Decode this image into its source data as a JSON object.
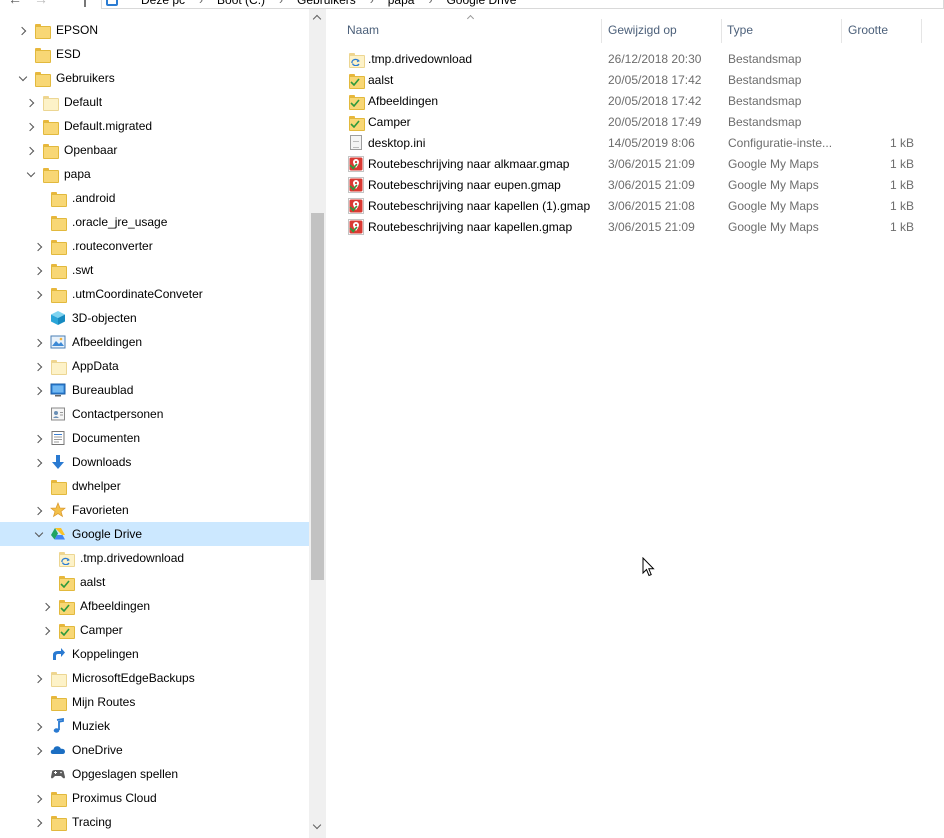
{
  "address": {
    "breadcrumbs": [
      "Deze pc",
      "Boot (C:)",
      "Gebruikers",
      "papa",
      "Google Drive"
    ],
    "separator": "›"
  },
  "nav": {
    "items": [
      {
        "label": "EPSON",
        "indent": 0,
        "expander": "collapsed",
        "icon": "folder-icon"
      },
      {
        "label": "ESD",
        "indent": 0,
        "expander": "none",
        "icon": "folder-icon"
      },
      {
        "label": "Gebruikers",
        "indent": 0,
        "expander": "expanded",
        "icon": "folder-icon"
      },
      {
        "label": "Default",
        "indent": 1,
        "expander": "collapsed",
        "icon": "folder-pale-icon"
      },
      {
        "label": "Default.migrated",
        "indent": 1,
        "expander": "collapsed",
        "icon": "folder-icon"
      },
      {
        "label": "Openbaar",
        "indent": 1,
        "expander": "collapsed",
        "icon": "folder-icon"
      },
      {
        "label": "papa",
        "indent": 1,
        "expander": "expanded",
        "icon": "folder-icon"
      },
      {
        "label": ".android",
        "indent": 2,
        "expander": "none",
        "icon": "folder-icon"
      },
      {
        "label": ".oracle_jre_usage",
        "indent": 2,
        "expander": "none",
        "icon": "folder-icon"
      },
      {
        "label": ".routeconverter",
        "indent": 2,
        "expander": "collapsed",
        "icon": "folder-icon"
      },
      {
        "label": ".swt",
        "indent": 2,
        "expander": "collapsed",
        "icon": "folder-icon"
      },
      {
        "label": ".utmCoordinateConveter",
        "indent": 2,
        "expander": "collapsed",
        "icon": "folder-icon"
      },
      {
        "label": "3D-objecten",
        "indent": 2,
        "expander": "none",
        "icon": "cube-3d-icon"
      },
      {
        "label": "Afbeeldingen",
        "indent": 2,
        "expander": "collapsed",
        "icon": "pictures-icon"
      },
      {
        "label": "AppData",
        "indent": 2,
        "expander": "collapsed",
        "icon": "folder-pale-icon"
      },
      {
        "label": "Bureaublad",
        "indent": 2,
        "expander": "collapsed",
        "icon": "desktop-icon"
      },
      {
        "label": "Contactpersonen",
        "indent": 2,
        "expander": "none",
        "icon": "contacts-icon"
      },
      {
        "label": "Documenten",
        "indent": 2,
        "expander": "collapsed",
        "icon": "documents-icon"
      },
      {
        "label": "Downloads",
        "indent": 2,
        "expander": "collapsed",
        "icon": "download-arrow-icon"
      },
      {
        "label": "dwhelper",
        "indent": 2,
        "expander": "none",
        "icon": "folder-icon"
      },
      {
        "label": "Favorieten",
        "indent": 2,
        "expander": "collapsed",
        "icon": "star-icon"
      },
      {
        "label": "Google Drive",
        "indent": 2,
        "expander": "expanded",
        "icon": "google-drive-icon",
        "selected": true
      },
      {
        "label": ".tmp.drivedownload",
        "indent": 3,
        "expander": "none",
        "icon": "folder-sync-icon"
      },
      {
        "label": "aalst",
        "indent": 3,
        "expander": "none",
        "icon": "folder-check-icon"
      },
      {
        "label": "Afbeeldingen",
        "indent": 3,
        "expander": "collapsed",
        "icon": "folder-check-icon"
      },
      {
        "label": "Camper",
        "indent": 3,
        "expander": "collapsed",
        "icon": "folder-check-icon"
      },
      {
        "label": "Koppelingen",
        "indent": 2,
        "expander": "none",
        "icon": "link-arrow-icon"
      },
      {
        "label": "MicrosoftEdgeBackups",
        "indent": 2,
        "expander": "collapsed",
        "icon": "folder-pale-icon"
      },
      {
        "label": "Mijn Routes",
        "indent": 2,
        "expander": "none",
        "icon": "folder-icon"
      },
      {
        "label": "Muziek",
        "indent": 2,
        "expander": "collapsed",
        "icon": "music-note-icon"
      },
      {
        "label": "OneDrive",
        "indent": 2,
        "expander": "collapsed",
        "icon": "onedrive-cloud-icon"
      },
      {
        "label": "Opgeslagen spellen",
        "indent": 2,
        "expander": "none",
        "icon": "gamepad-icon"
      },
      {
        "label": "Proximus Cloud",
        "indent": 2,
        "expander": "collapsed",
        "icon": "folder-icon"
      },
      {
        "label": "Tracing",
        "indent": 2,
        "expander": "collapsed",
        "icon": "folder-icon"
      }
    ]
  },
  "columns": {
    "name": "Naam",
    "modified": "Gewijzigd op",
    "type": "Type",
    "size": "Grootte"
  },
  "files": [
    {
      "name": ".tmp.drivedownload",
      "date": "26/12/2018 20:30",
      "type": "Bestandsmap",
      "size": "",
      "icon": "folder-sync-icon"
    },
    {
      "name": "aalst",
      "date": "20/05/2018 17:42",
      "type": "Bestandsmap",
      "size": "",
      "icon": "folder-check-icon"
    },
    {
      "name": "Afbeeldingen",
      "date": "20/05/2018 17:42",
      "type": "Bestandsmap",
      "size": "",
      "icon": "folder-check-icon"
    },
    {
      "name": "Camper",
      "date": "20/05/2018 17:49",
      "type": "Bestandsmap",
      "size": "",
      "icon": "folder-check-icon"
    },
    {
      "name": "desktop.ini",
      "date": "14/05/2019 8:06",
      "type": "Configuratie-inste...",
      "size": "1 kB",
      "icon": "ini-file-icon"
    },
    {
      "name": "Routebeschrijving naar alkmaar.gmap",
      "date": "3/06/2015 21:09",
      "type": "Google My Maps",
      "size": "1 kB",
      "icon": "gmap-file-icon"
    },
    {
      "name": "Routebeschrijving naar eupen.gmap",
      "date": "3/06/2015 21:09",
      "type": "Google My Maps",
      "size": "1 kB",
      "icon": "gmap-file-icon"
    },
    {
      "name": "Routebeschrijving naar kapellen (1).gmap",
      "date": "3/06/2015 21:08",
      "type": "Google My Maps",
      "size": "1 kB",
      "icon": "gmap-file-icon"
    },
    {
      "name": "Routebeschrijving naar kapellen.gmap",
      "date": "3/06/2015 21:09",
      "type": "Google My Maps",
      "size": "1 kB",
      "icon": "gmap-file-icon"
    }
  ],
  "colors": {
    "selection": "#cce8ff",
    "header_text": "#4c607a",
    "folder": "#f8d775",
    "check": "#2e9a3d"
  }
}
